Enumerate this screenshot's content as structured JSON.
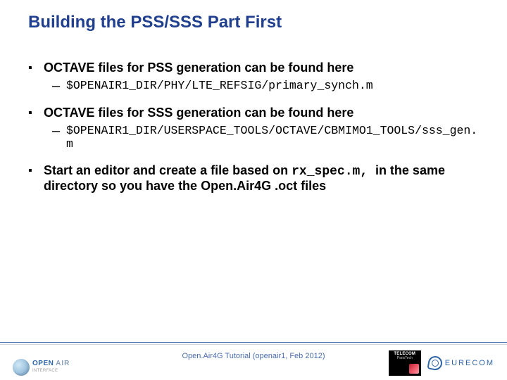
{
  "title": "Building the PSS/SSS Part First",
  "bullets": {
    "b1": "OCTAVE files for PSS generation can be found here",
    "b1a": "$OPENAIR1_DIR/PHY/LTE_REFSIG/primary_synch.m",
    "b2": "OCTAVE files for SSS generation can be found here",
    "b2a": "$OPENAIR1_DIR/USERSPACE_TOOLS/OCTAVE/CBMIMO1_TOOLS/sss_gen.m",
    "b3_pre": "Start an editor and create a file based on ",
    "b3_mono": "rx_spec.m, ",
    "b3_post": "in the same directory so you have the Open.Air4G .oct files"
  },
  "footer": {
    "caption": "Open.Air4G Tutorial (openair1, Feb 2012)",
    "logo_left_open": "OPEN",
    "logo_left_air": "AIR",
    "logo_left_sub": "INTERFACE",
    "telecom_l1": "TELECOM",
    "telecom_l2": "ParisTech",
    "eurecom": "EURECOM"
  }
}
